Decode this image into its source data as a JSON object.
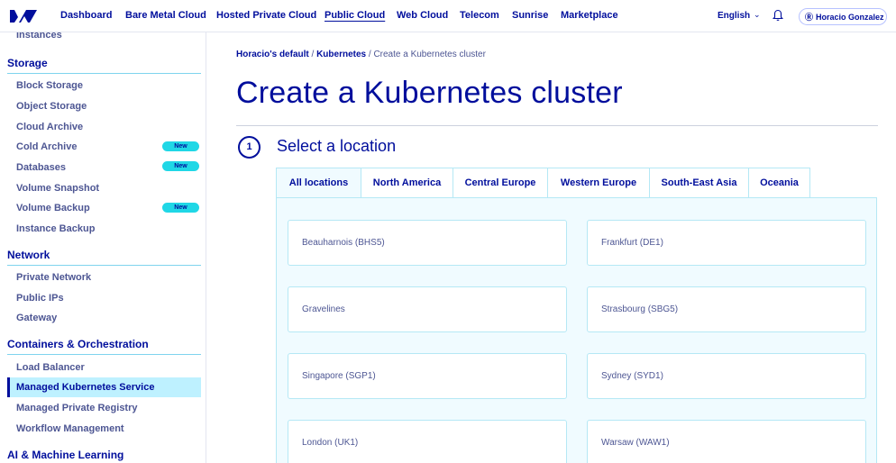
{
  "topnav": {
    "links": [
      "Dashboard",
      "Bare Metal Cloud",
      "Hosted Private Cloud",
      "Public Cloud",
      "Web Cloud",
      "Telecom",
      "Sunrise",
      "Marketplace"
    ],
    "active": "Public Cloud",
    "language": "English",
    "user_name": "Horacio Gonzalez",
    "accent_color": "#000e9c"
  },
  "sidebar": {
    "top_item": "Instances",
    "sections": {
      "storage": {
        "heading": "Storage",
        "items": [
          "Block Storage",
          "Object Storage",
          "Cloud Archive",
          "Cold Archive",
          "Databases",
          "Volume Snapshot",
          "Volume Backup",
          "Instance Backup"
        ]
      },
      "network": {
        "heading": "Network",
        "items": [
          "Private Network",
          "Public IPs",
          "Gateway"
        ]
      },
      "containers": {
        "heading": "Containers & Orchestration",
        "items": [
          "Load Balancer",
          "Managed Kubernetes Service",
          "Managed Private Registry",
          "Workflow Management"
        ]
      },
      "ai": {
        "heading": "AI & Machine Learning"
      }
    },
    "badge_label": "New",
    "active_item": "Managed Kubernetes Service",
    "badge_color": "#20d7e6",
    "active_bg_color": "#bef1ff"
  },
  "breadcrumb": {
    "items": [
      "Horacio's default",
      "Kubernetes",
      "Create a Kubernetes cluster"
    ],
    "separator": "/"
  },
  "page": {
    "title": "Create a Kubernetes cluster"
  },
  "step": {
    "number": "1",
    "title": "Select a location"
  },
  "location_tabs": [
    "All locations",
    "North America",
    "Central Europe",
    "Western Europe",
    "South-East Asia",
    "Oceania"
  ],
  "active_tab": "All locations",
  "locations": [
    "Beauharnois (BHS5)",
    "Frankfurt (DE1)",
    "Gravelines",
    "Strasbourg (SBG5)",
    "Singapore (SGP1)",
    "Sydney (SYD1)",
    "London (UK1)",
    "Warsaw (WAW1)"
  ]
}
